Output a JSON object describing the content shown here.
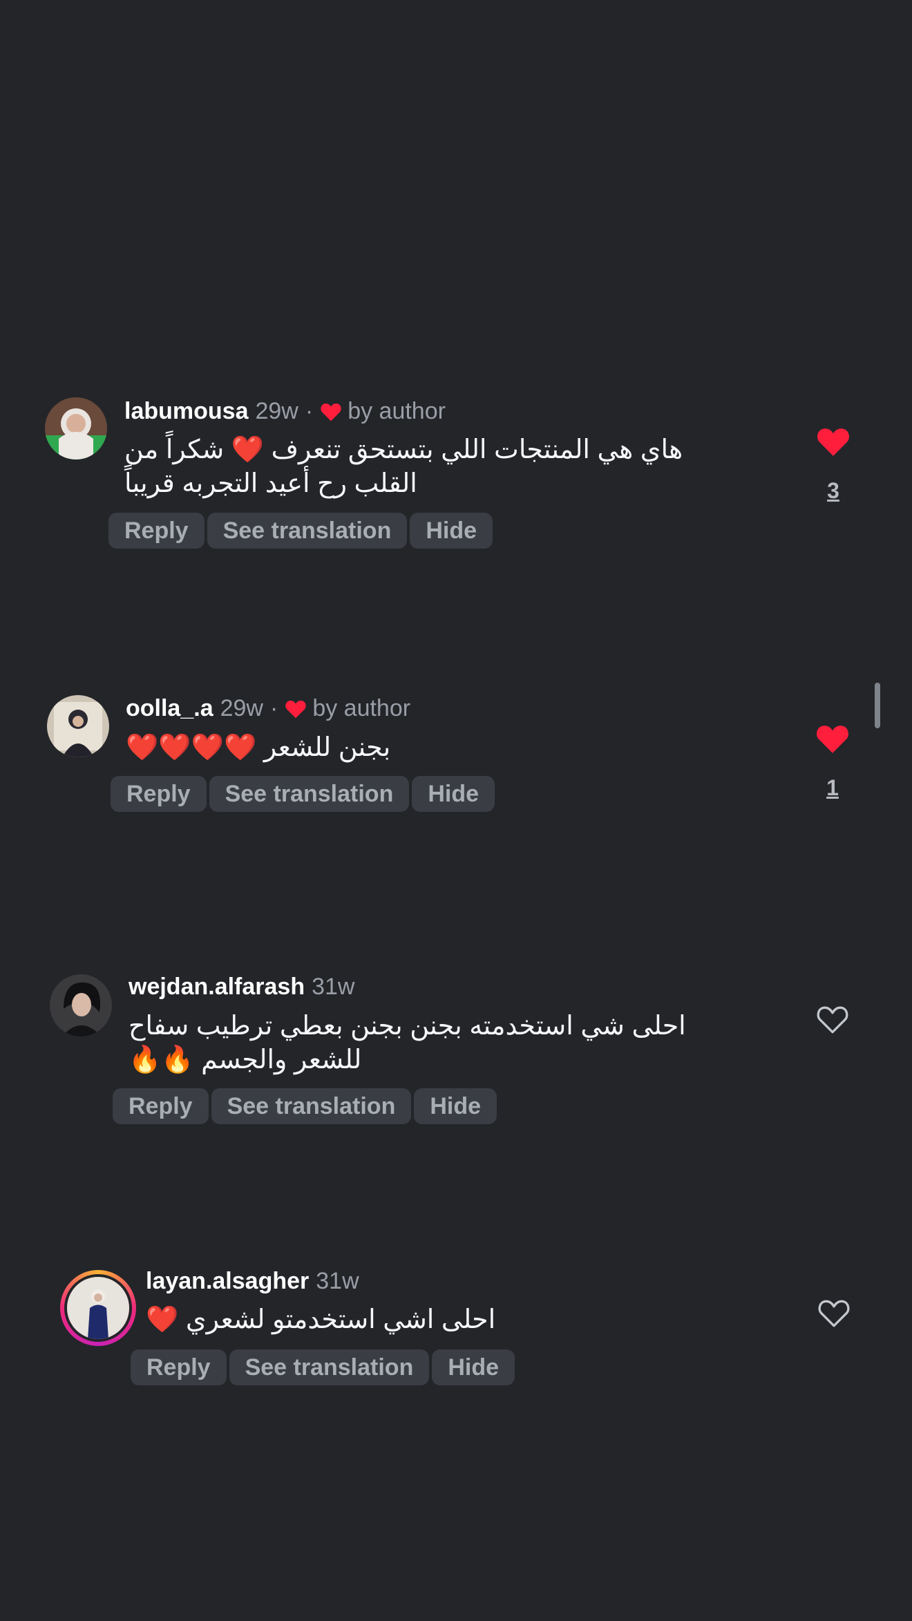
{
  "comments": [
    {
      "username": "labumousa",
      "time": "29w",
      "by_author_label": "by author",
      "text_lines": [
        "هاي هي المنتجات اللي بتستحق تنعرف ❤️ شكراً من",
        "القلب رح أعيد التجربه قريباً"
      ],
      "actions": {
        "reply": "Reply",
        "translate": "See translation",
        "hide": "Hide"
      },
      "like_count": "3",
      "liked": true
    },
    {
      "username": "oolla_.a",
      "time": "29w",
      "by_author_label": "by author",
      "text_lines": [
        "بجنن للشعر ❤️❤️❤️❤️"
      ],
      "actions": {
        "reply": "Reply",
        "translate": "See translation",
        "hide": "Hide"
      },
      "like_count": "1",
      "liked": true
    },
    {
      "username": "wejdan.alfarash",
      "time": "31w",
      "text_lines": [
        "احلى شي استخدمته بجنن بجنن بعطي ترطيب سفاح",
        "للشعر والجسم 🔥🔥"
      ],
      "actions": {
        "reply": "Reply",
        "translate": "See translation",
        "hide": "Hide"
      },
      "liked": false
    },
    {
      "username": "layan.alsagher",
      "time": "31w",
      "text_lines": [
        "احلى اشي استخدمتو لشعري ❤️"
      ],
      "actions": {
        "reply": "Reply",
        "translate": "See translation",
        "hide": "Hide"
      },
      "liked": false
    }
  ],
  "colors": {
    "background": "#232529",
    "like_red": "#ff1f3d",
    "pill_bg": "#3a3d44",
    "muted": "#9a9ea6"
  }
}
